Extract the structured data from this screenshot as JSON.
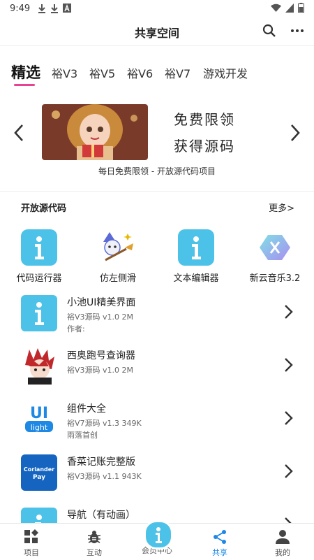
{
  "status": {
    "time": "9:49"
  },
  "header": {
    "title": "共享空间"
  },
  "tabs": [
    "精选",
    "裕V3",
    "裕V5",
    "裕V6",
    "裕V7",
    "游戏开发"
  ],
  "banner": {
    "line1": "免费限领",
    "line2": "获得源码",
    "caption": "每日免费限领 - 开放源代码项目"
  },
  "section": {
    "title": "开放源代码",
    "more": "更多>"
  },
  "apps": [
    {
      "name": "代码运行器",
      "icon": "info-app-icon"
    },
    {
      "name": "仿左侧滑",
      "icon": "wizard-app-icon"
    },
    {
      "name": "文本编辑器",
      "icon": "info-app-icon"
    },
    {
      "name": "新云音乐3.2",
      "icon": "hexagon-x-app-icon"
    }
  ],
  "list": [
    {
      "title": "小池UI精美界面",
      "sub": "裕V3源码  v1.0  2M",
      "author": "作者:"
    },
    {
      "title": "西奥跑号查询器",
      "sub": "裕V3源码  v1.0  2M",
      "author": ""
    },
    {
      "title": "组件大全",
      "sub": "裕V7源码  v1.3  349K",
      "author": "雨落首创"
    },
    {
      "title": "香菜记账完整版",
      "sub": "裕V3源码  v1.1  943K",
      "author": ""
    },
    {
      "title": "导航（有动画）",
      "sub": "",
      "author": ""
    }
  ],
  "icons": {
    "coriander_line1": "Coriander",
    "coriander_line2": "Pay",
    "ui_logo_line1": "UI",
    "ui_logo_line2": "light"
  },
  "nav": [
    {
      "label": "项目",
      "icon": "grid-icon"
    },
    {
      "label": "互动",
      "icon": "bug-icon"
    },
    {
      "label": "会员中心",
      "icon": "info-icon"
    },
    {
      "label": "共享",
      "icon": "share-icon"
    },
    {
      "label": "我的",
      "icon": "person-icon"
    }
  ],
  "colors": {
    "accent": "#e84393",
    "active": "#1e88e5",
    "appBlue": "#4cc2e8"
  }
}
